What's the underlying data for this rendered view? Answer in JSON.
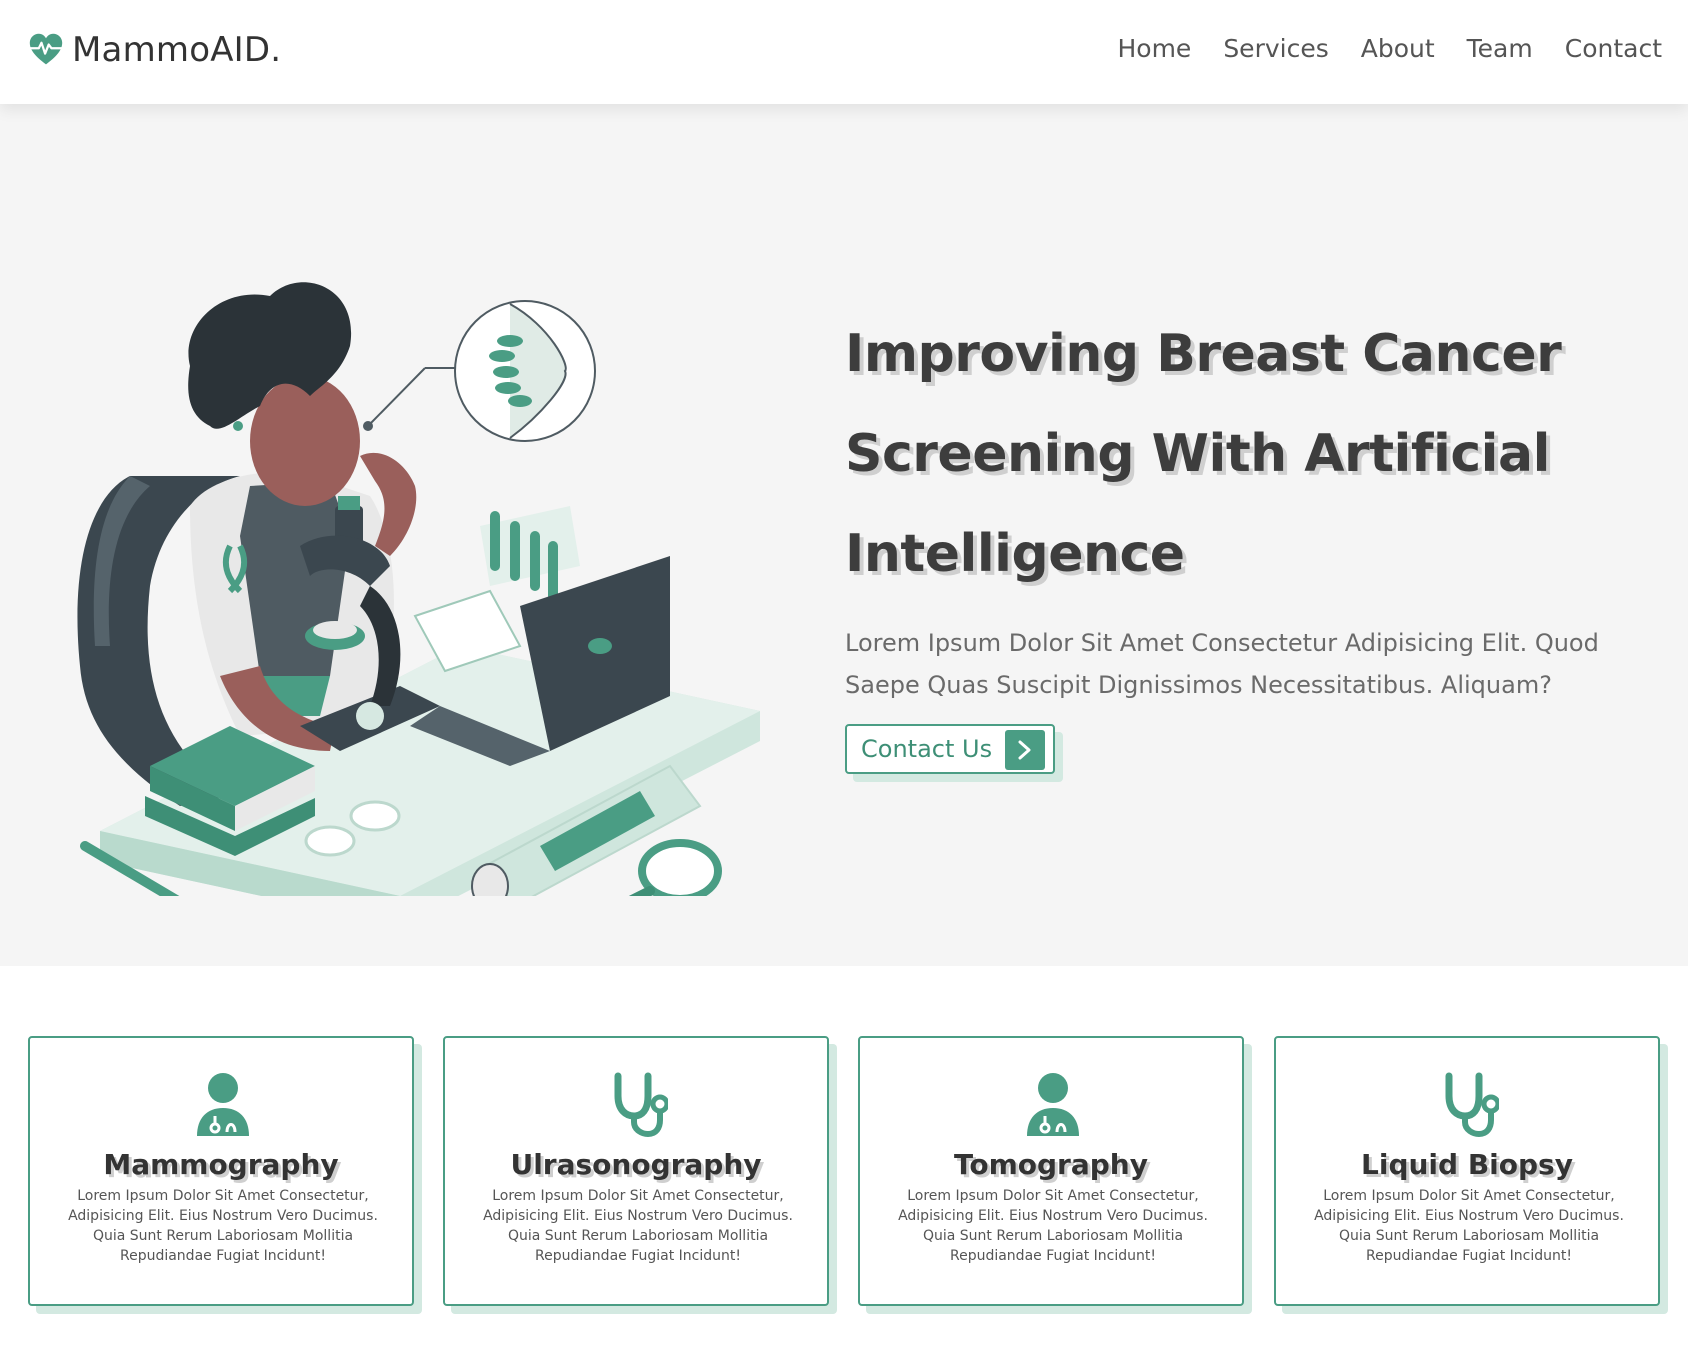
{
  "brand": {
    "name": "MammoAID.",
    "logo_icon": "heartbeat-icon",
    "accent": "#4a9d84"
  },
  "nav": {
    "items": [
      {
        "label": "Home"
      },
      {
        "label": "Services"
      },
      {
        "label": "About"
      },
      {
        "label": "Team"
      },
      {
        "label": "Contact"
      }
    ]
  },
  "hero": {
    "title_lines": [
      "Improving Breast Cancer",
      "Screening With Artificial",
      "Intelligence"
    ],
    "description": "Lorem Ipsum Dolor Sit Amet Consectetur Adipisicing Elit. Quod Saepe Quas Suscipit Dignissimos Necessitatibus. Aliquam?",
    "cta_label": "Contact Us",
    "cta_icon": "chevron-right-icon",
    "illustration": "doctor-with-microscope-illustration"
  },
  "cards": [
    {
      "icon": "user-doctor-icon",
      "title": "Mammography",
      "description": "Lorem Ipsum Dolor Sit Amet Consectetur, Adipisicing Elit. Eius Nostrum Vero Ducimus. Quia Sunt Rerum Laboriosam Mollitia Repudiandae Fugiat Incidunt!"
    },
    {
      "icon": "stethoscope-icon",
      "title": "Ulrasonography",
      "description": "Lorem Ipsum Dolor Sit Amet Consectetur, Adipisicing Elit. Eius Nostrum Vero Ducimus. Quia Sunt Rerum Laboriosam Mollitia Repudiandae Fugiat Incidunt!"
    },
    {
      "icon": "user-doctor-icon",
      "title": "Tomography",
      "description": "Lorem Ipsum Dolor Sit Amet Consectetur, Adipisicing Elit. Eius Nostrum Vero Ducimus. Quia Sunt Rerum Laboriosam Mollitia Repudiandae Fugiat Incidunt!"
    },
    {
      "icon": "stethoscope-icon",
      "title": "Liquid Biopsy",
      "description": "Lorem Ipsum Dolor Sit Amet Consectetur, Adipisicing Elit. Eius Nostrum Vero Ducimus. Quia Sunt Rerum Laboriosam Mollitia Repudiandae Fugiat Incidunt!"
    }
  ]
}
